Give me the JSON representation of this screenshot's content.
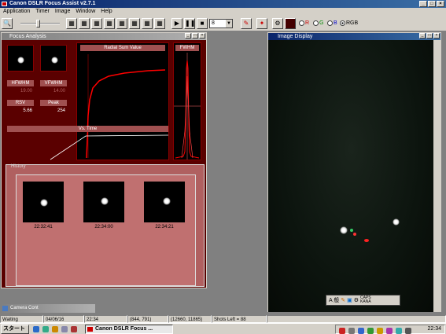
{
  "app": {
    "title": "Canon DSLR Focus Assist v2.7.1"
  },
  "menu": [
    "Application",
    "Timer",
    "Image",
    "Window",
    "Help"
  ],
  "toolbar": {
    "exposure_value": "8",
    "radio_r": "R",
    "radio_g": "G",
    "radio_b": "B",
    "radio_rgb": "RGB",
    "selected_channel": "RGB"
  },
  "focus_analysis": {
    "title": "Focus Analysis",
    "hfwhm_label": "HFWHM",
    "hfwhm_value": "19.00",
    "vfwhm_label": "VFWHM",
    "vfwhm_value": "14.00",
    "rsv_label": "RSV",
    "rsv_value": "5.66",
    "peak_label": "Peak",
    "peak_value": "254",
    "radial_title": "Radial Sum Value",
    "fwhm_title": "FWHM",
    "vstime_title": "Vs. Time",
    "history_label": "History",
    "history": [
      {
        "time": "22:32:41"
      },
      {
        "time": "22:34:00"
      },
      {
        "time": "22:34:21"
      }
    ]
  },
  "camera_window": {
    "title": "Camera Cont"
  },
  "image_display": {
    "title": "Image Display"
  },
  "ime_bar": {
    "text": "A 般",
    "caps": "CAPS",
    "kana": "KANA"
  },
  "status": {
    "state": "Waiting",
    "date": "04/06/16",
    "time": "22:34",
    "cursor": "(844, 791)",
    "region": "(12660, 11865)",
    "shots": "Shots Left = 88"
  },
  "taskbar": {
    "start_label": "スタート",
    "task_label": "Canon DSLR Focus ...",
    "clock": "22:34"
  }
}
